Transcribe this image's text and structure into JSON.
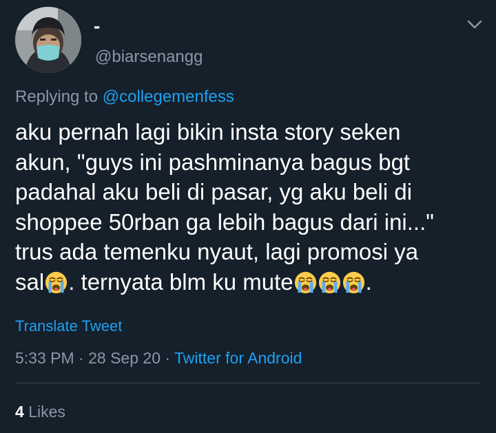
{
  "author": {
    "display_name": "-",
    "handle": "@biarsenangg",
    "avatar_icon": "profile-photo-person-with-mask"
  },
  "header": {
    "more_icon": "chevron-down-icon"
  },
  "reply": {
    "prefix": "Replying to",
    "mention": "@collegemenfess"
  },
  "tweet": {
    "line_1": "aku pernah lagi bikin insta story seken",
    "line_2": "akun, \"guys ini pashminanya bagus bgt",
    "line_3": "padahal aku beli di pasar, yg aku beli di",
    "line_4": "shoppee 50rban ga lebih bagus dari ini...\"",
    "line_5": "trus ada temenku nyaut, lagi promosi ya",
    "line_6_a": "sal",
    "line_6_b": ". ternyata blm ku mute",
    "line_6_c": ".",
    "emoji_icon": "loudly-crying-face"
  },
  "translate_label": "Translate Tweet",
  "meta": {
    "time": "5:33 PM",
    "separator": "·",
    "date": "28 Sep 20",
    "source": "Twitter for Android"
  },
  "stats": {
    "likes_count": "4",
    "likes_label": "Likes"
  },
  "colors": {
    "background": "#15202b",
    "text_primary": "#ffffff",
    "text_secondary": "#8899a6",
    "accent": "#1da1f2",
    "divider": "#38444d"
  }
}
